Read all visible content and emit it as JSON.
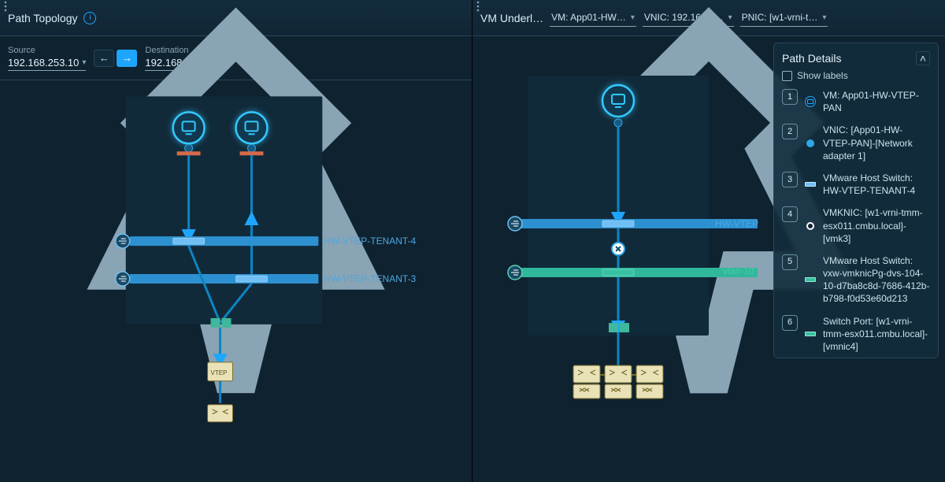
{
  "left": {
    "title": "Path Topology",
    "source_label": "Source",
    "source_value": "192.168.253.10",
    "dest_label": "Destination",
    "dest_value": "192.168.252.10",
    "tenant_a": "HW-VTEP-TENANT-4",
    "tenant_b": "HW-VTEP-TENANT-3",
    "vtep_label": "VTEP"
  },
  "right": {
    "title": "VM Underl…",
    "vm_dd": "VM: App01-HW…",
    "vnic_dd": "VNIC: 192.168.2…",
    "pnic_dd": "PNIC: [w1-vrni-t…",
    "net_a": "HW-VTEP",
    "net_b": "vlan-10",
    "details_title": "Path Details",
    "show_labels": "Show labels",
    "steps": [
      {
        "n": "1",
        "txt": "VM: App01-HW-VTEP-PAN",
        "icon": "vm"
      },
      {
        "n": "2",
        "txt": "VNIC: [App01-HW-VTEP-PAN]-[Network adapter 1]",
        "icon": "dot"
      },
      {
        "n": "3",
        "txt": "VMware Host Switch: HW-VTEP-TENANT-4",
        "icon": "chip"
      },
      {
        "n": "4",
        "txt": "VMKNIC: [w1-vrni-tmm-esx011.cmbu.local]-[vmk3]",
        "icon": "port"
      },
      {
        "n": "5",
        "txt": "VMware Host Switch: vxw-vmknicPg-dvs-104-10-d7ba8c8d-7686-412b-b798-f0d53e60d213",
        "icon": "chip-teal"
      },
      {
        "n": "6",
        "txt": "Switch Port: [w1-vrni-tmm-esx011.cmbu.local]-[vmnic4]",
        "icon": "chip-teal"
      }
    ]
  }
}
